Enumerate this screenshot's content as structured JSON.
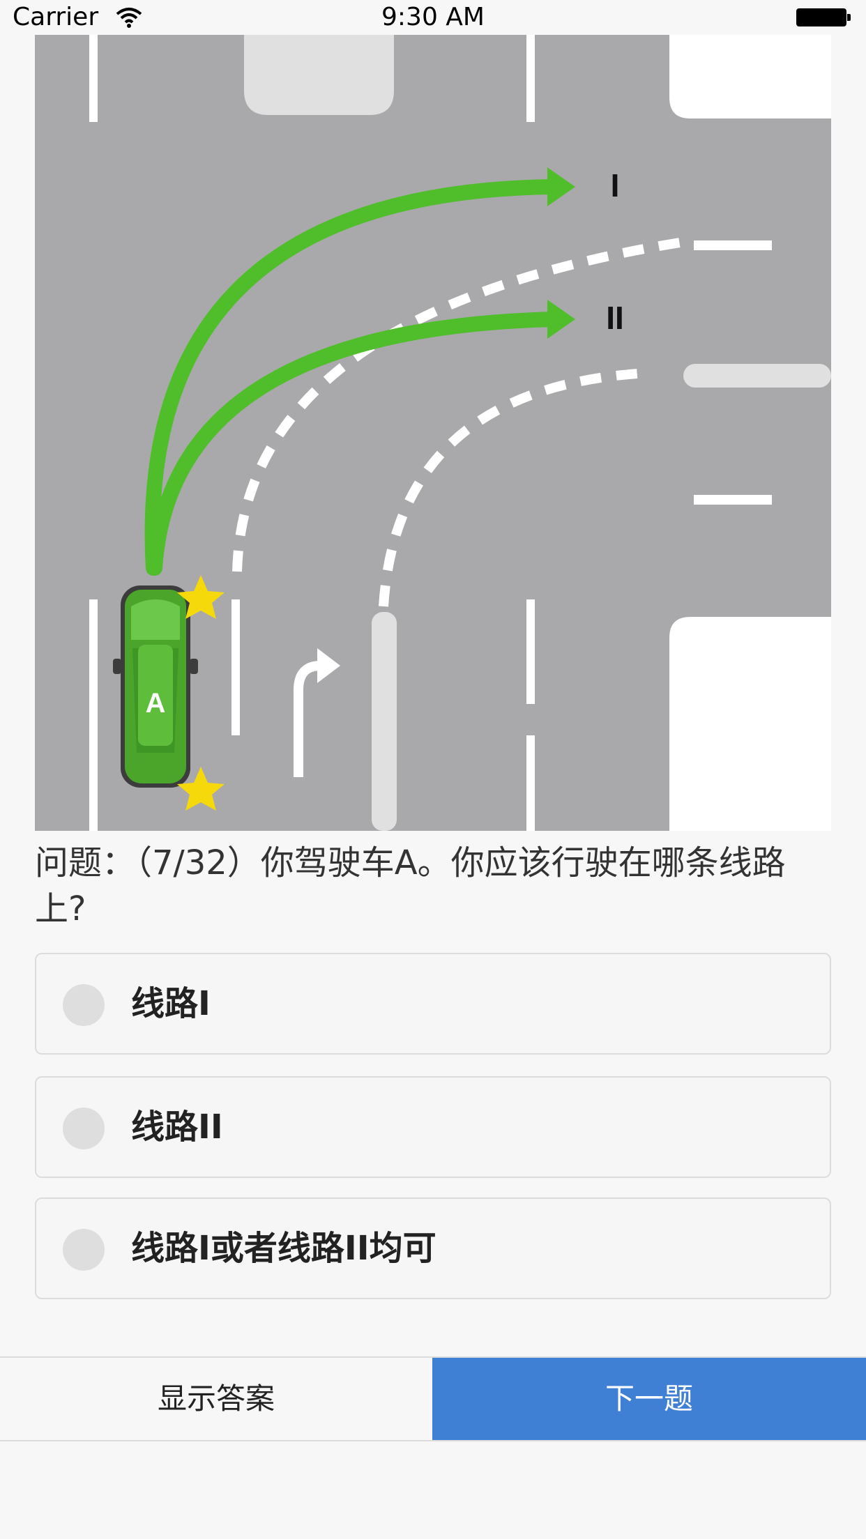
{
  "status_bar": {
    "carrier": "Carrier",
    "time": "9:30 AM"
  },
  "figure": {
    "route_labels": [
      "I",
      "II"
    ],
    "car_label": "A",
    "colors": {
      "road": "#a9a9ac",
      "arrow": "#4fbe2a",
      "car": "#4aa52a",
      "lane_marking": "#ffffff",
      "flash": "#f5d90a"
    }
  },
  "question": {
    "text": "问题：（7/32）你驾驶车A。你应该行驶在哪条线路上?"
  },
  "options": [
    {
      "label": "线路I"
    },
    {
      "label": "线路II"
    },
    {
      "label": "线路I或者线路II均可"
    }
  ],
  "buttons": {
    "show_answer": "显示答案",
    "next": "下一题"
  },
  "colors": {
    "accent": "#3f7fd4",
    "background": "#f7f7f7"
  }
}
